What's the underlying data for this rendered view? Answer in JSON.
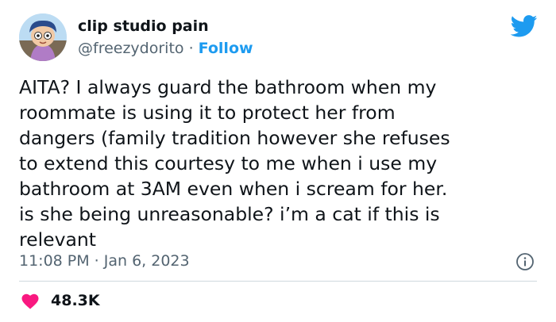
{
  "author": {
    "display_name": "clip studio pain",
    "handle": "@freezydorito",
    "separator": " · ",
    "follow_label": "Follow"
  },
  "tweet": {
    "lines": [
      "AITA? I always guard the bathroom when my",
      "roommate is using it to protect her from",
      "dangers (family tradition however she refuses",
      "to extend this courtesy to me when i use my",
      "bathroom at 3AM even when i scream for her.",
      "is she being unreasonable? i’m a cat if this is",
      "relevant"
    ],
    "timestamp": "11:08 PM · Jan 6, 2023",
    "like_count": "48.3K"
  },
  "icons": {
    "brand": "twitter-bird-icon",
    "info": "info-icon",
    "like": "heart-icon"
  },
  "colors": {
    "accent": "#1d9bf0",
    "like": "#f91880",
    "secondary_text": "#536471",
    "divider": "#cfd9de"
  }
}
